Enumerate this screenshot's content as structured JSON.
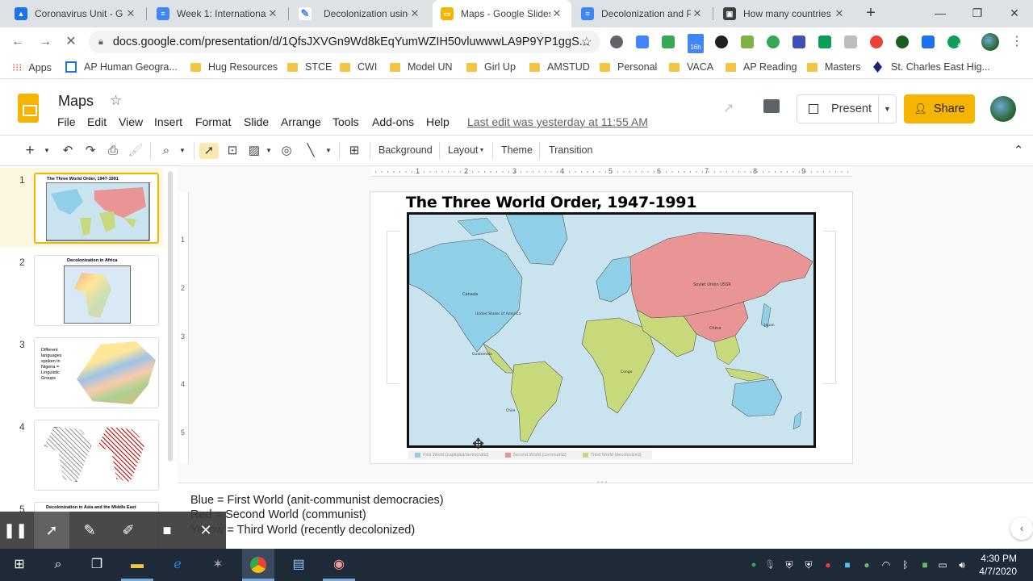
{
  "tabs": [
    {
      "title": "Coronavirus Unit - G",
      "icon": "google-drive-icon",
      "color": "#1a73e8",
      "active": false
    },
    {
      "title": "Week 1: Internationa",
      "icon": "docs-icon",
      "color": "#4285f4",
      "active": false
    },
    {
      "title": "Decolonization using",
      "icon": "web-icon",
      "color": "#4285f4",
      "active": false
    },
    {
      "title": "Maps - Google Slides",
      "icon": "slides-icon",
      "color": "#f4b400",
      "active": true
    },
    {
      "title": "Decolonization and P",
      "icon": "docs-icon",
      "color": "#4285f4",
      "active": false
    },
    {
      "title": "How many countries",
      "icon": "web-icon",
      "color": "#3c4043",
      "active": false
    }
  ],
  "url": "docs.google.com/presentation/d/1QfsJXVGn9Wd8kEqYumWZIH50vluwwwLA9P9YP1ggS...",
  "bookmarks": [
    "Apps",
    "AP Human Geogra...",
    "Hug Resources",
    "STCE",
    "CWI",
    "Model UN",
    "Girl Up",
    "AMSTUD",
    "Personal",
    "VACA",
    "AP Reading",
    "Masters",
    "St. Charles East Hig..."
  ],
  "extension_badges": {
    "calendar": "16h",
    "hangouts": "4"
  },
  "doc": {
    "title": "Maps",
    "menu": [
      "File",
      "Edit",
      "View",
      "Insert",
      "Format",
      "Slide",
      "Arrange",
      "Tools",
      "Add-ons",
      "Help"
    ],
    "last_edit": "Last edit was yesterday at 11:55 AM",
    "present_label": "Present",
    "share_label": "Share"
  },
  "toolbar": {
    "background": "Background",
    "layout": "Layout",
    "theme": "Theme",
    "transition": "Transition"
  },
  "ruler": {
    "h": [
      "1",
      "2",
      "3",
      "4",
      "5",
      "6",
      "7",
      "8",
      "9"
    ],
    "v": [
      "1",
      "2",
      "3",
      "4",
      "5"
    ]
  },
  "slides": [
    {
      "num": "1",
      "title": "The Three World Order, 1947-1991"
    },
    {
      "num": "2",
      "title": "Decolonization in Africa"
    },
    {
      "num": "3",
      "title": "Different languages spoken in Nigeria = Linguistic Groups"
    },
    {
      "num": "4",
      "title": ""
    },
    {
      "num": "5",
      "title": "Decolonization in Asia and the Middle East"
    }
  ],
  "slide": {
    "title": "The Three World Order, 1947-1991",
    "map_labels": {
      "soviet": "Soviet Union USSR",
      "us": "United States of America",
      "canada": "Canada",
      "china": "China",
      "japan": "Japan",
      "guatemala": "Guatemala",
      "congo": "Congo",
      "chile": "Chile"
    },
    "legend": [
      "First World (capitalist/democratic)",
      "Second World (communist)",
      "Third World (decolonized)"
    ],
    "colors": {
      "first": "#8fd0e8",
      "second": "#e99595",
      "third": "#c7d97a",
      "ocean": "#c9e4ef"
    }
  },
  "notes": [
    "Blue = First World (anit-communist democracies)",
    "Red = Second World (communist)",
    "Yellow = Third World (recently decolonized)"
  ],
  "recorder": [
    "pause-icon",
    "cursor-icon",
    "pen-icon",
    "highlighter-icon",
    "camera-icon",
    "close-icon"
  ],
  "taskbar": {
    "time": "4:30 PM",
    "date": "4/7/2020"
  }
}
